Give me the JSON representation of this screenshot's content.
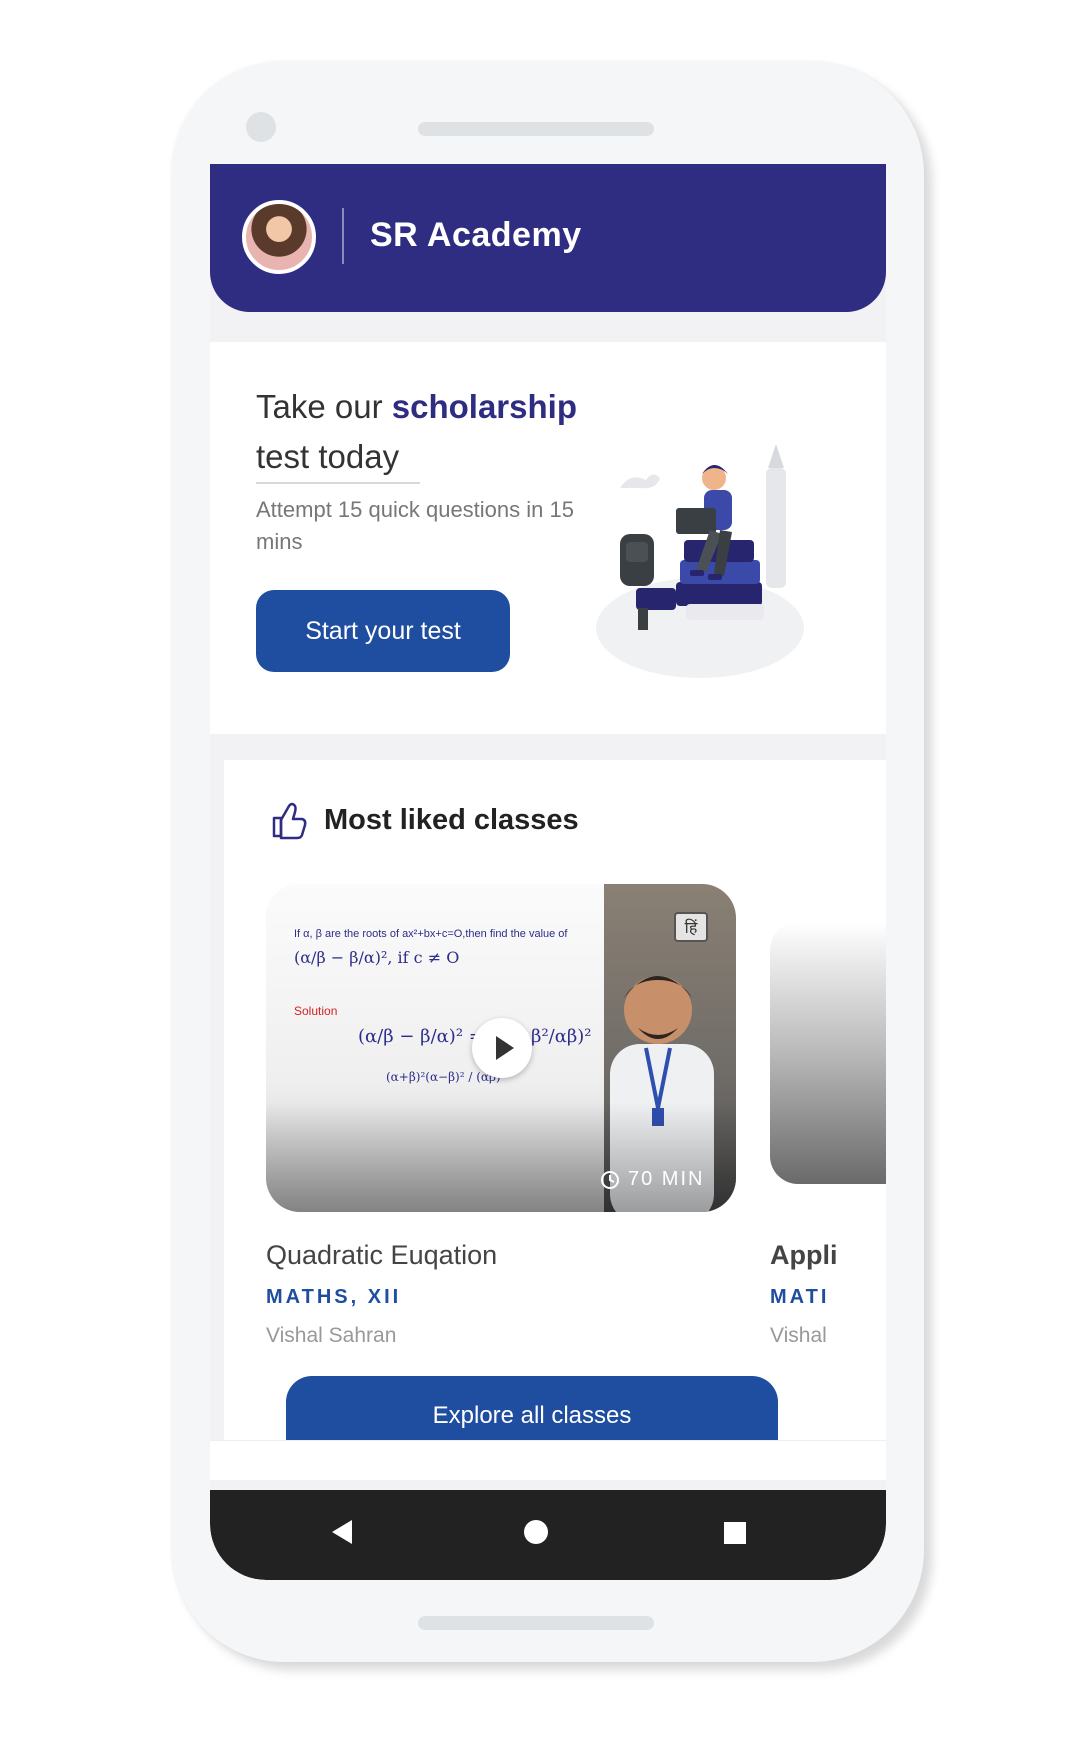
{
  "header": {
    "app_title": "SR Academy"
  },
  "promo": {
    "title_prefix": "Take our",
    "title_accent": "scholarship",
    "title_suffix": "test today",
    "subtitle": "Attempt 15 quick questions in 15 mins",
    "button_label": "Start your test"
  },
  "liked": {
    "title": "Most liked classes",
    "cards": [
      {
        "question_text": "If α, β are the roots of ax²+bx+c=O,then find the value of",
        "formula_1": "(α/β − β/α)², if c ≠ O",
        "solution_label": "Solution",
        "formula_2": "(α/β − β/α)² = (α²−β²/αβ)²",
        "formula_3": "(α+β)²(α−β)² / (αβ)²",
        "language_badge": "हिं",
        "duration": "70 MIN",
        "title": "Quadratic Euqation",
        "subject": "MATHS, XII",
        "teacher": "Vishal Sahran"
      },
      {
        "title": "Appli",
        "subject": "MATI",
        "teacher": "Vishal"
      }
    ],
    "explore_label": "Explore all classes"
  },
  "icons": {
    "thumbs": "thumbs-up-icon",
    "play": "play-icon",
    "clock": "clock-icon",
    "nav_back": "back-triangle-icon",
    "nav_home": "home-circle-icon",
    "nav_recent": "recent-square-icon"
  },
  "colors": {
    "brand": "#2f2d82",
    "button": "#1f4da0"
  }
}
